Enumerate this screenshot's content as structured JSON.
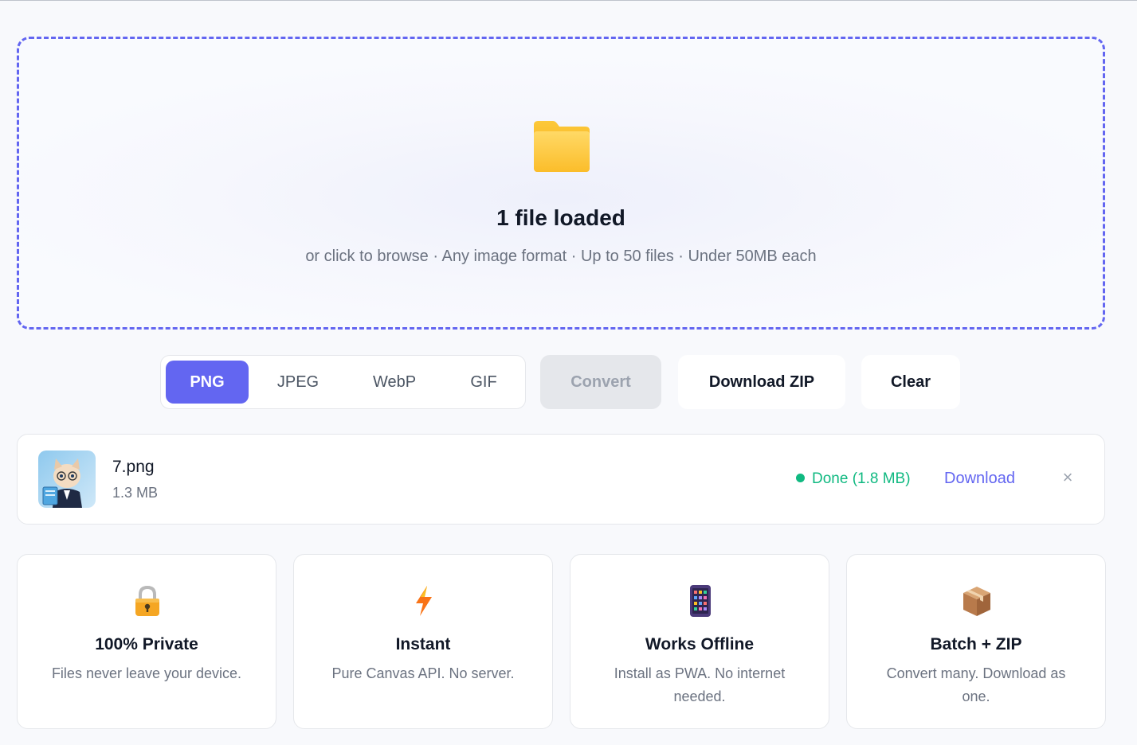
{
  "dropzone": {
    "title": "1 file loaded",
    "subtitle": "or click to browse · Any image format · Up to 50 files · Under 50MB each",
    "icon": "folder-icon"
  },
  "formats": {
    "selected": "PNG",
    "options": [
      "PNG",
      "JPEG",
      "WebP",
      "GIF"
    ]
  },
  "actions": {
    "convert_label": "Convert",
    "download_zip_label": "Download ZIP",
    "clear_label": "Clear"
  },
  "files": [
    {
      "name": "7.png",
      "size": "1.3 MB",
      "status": "Done (1.8 MB)",
      "download_label": "Download",
      "remove_label": "×"
    }
  ],
  "features": [
    {
      "icon": "lock-icon",
      "title": "100% Private",
      "description": "Files never leave your device."
    },
    {
      "icon": "lightning-icon",
      "title": "Instant",
      "description": "Pure Canvas API. No server."
    },
    {
      "icon": "mobile-phone-icon",
      "title": "Works Offline",
      "description": "Install as PWA. No internet needed."
    },
    {
      "icon": "package-icon",
      "title": "Batch + ZIP",
      "description": "Convert many. Download as one."
    }
  ],
  "colors": {
    "accent": "#6366f1",
    "success": "#10b981",
    "text_muted": "#6b7280"
  }
}
